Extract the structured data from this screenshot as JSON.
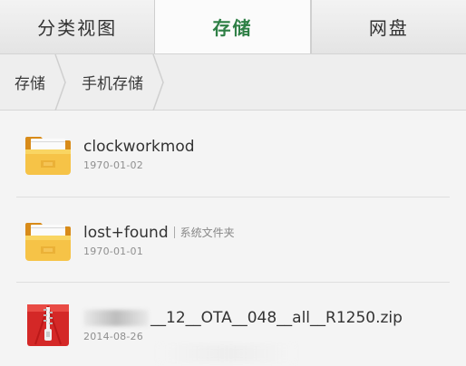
{
  "tabs": [
    {
      "label": "分类视图",
      "active": false
    },
    {
      "label": "存储",
      "active": true
    },
    {
      "label": "网盘",
      "active": false
    }
  ],
  "breadcrumb": [
    {
      "label": "存储"
    },
    {
      "label": "手机存储"
    }
  ],
  "files": [
    {
      "name": "clockworkmod",
      "date": "1970-01-02",
      "icon": "folder-icon",
      "tag": ""
    },
    {
      "name": "lost+found",
      "date": "1970-01-01",
      "icon": "folder-icon",
      "tag": "系统文件夹"
    },
    {
      "name": "__12__OTA__048__all__R1250.zip",
      "date": "2014-08-26",
      "icon": "zip-icon",
      "tag": ""
    }
  ],
  "colors": {
    "active_tab": "#2e7f45",
    "folder": "#f2b634",
    "zip": "#d9292b"
  }
}
